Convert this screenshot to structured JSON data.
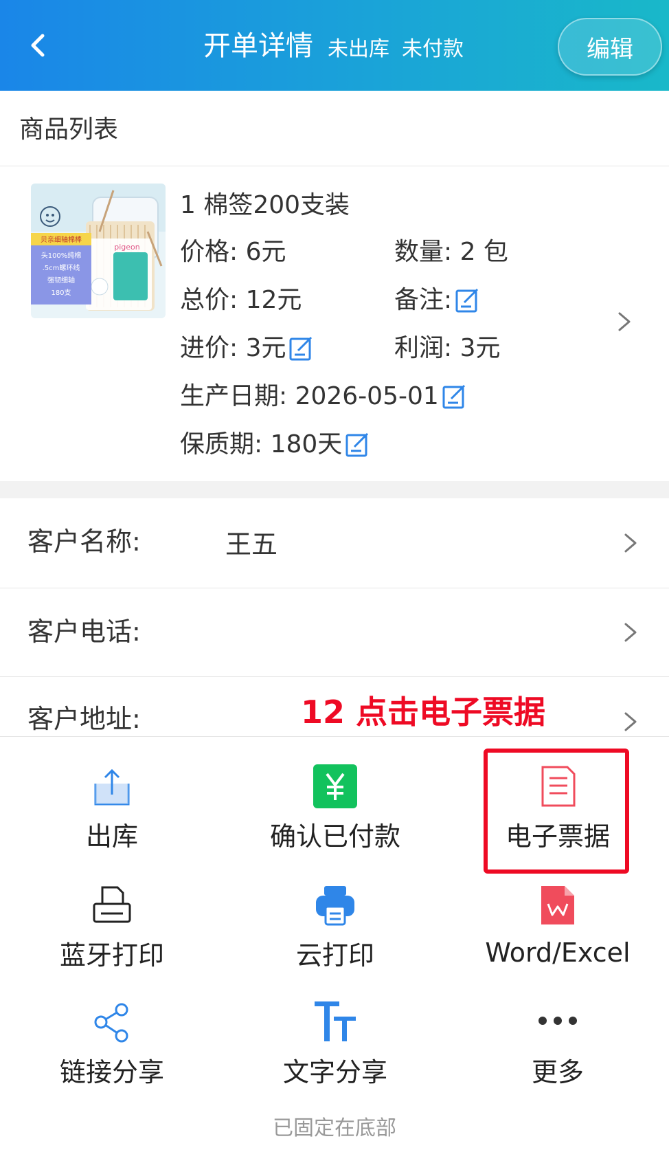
{
  "header": {
    "title": "开单详情",
    "status_stock": "未出库",
    "status_payment": "未付款",
    "edit_label": "编辑"
  },
  "product_section": {
    "title": "商品列表"
  },
  "product": {
    "name": "1 棉签200支装",
    "price": "价格: 6元",
    "quantity": "数量: 2 包",
    "total": "总价: 12元",
    "remark": "备注:",
    "cost": "进价: 3元",
    "profit": "利润: 3元",
    "production_date": "生产日期: 2026-05-01",
    "shelf_life": "保质期: 180天",
    "image_text": {
      "brand": "pigeon",
      "line1": "贝亲细轴棉棒",
      "line2": "头100%纯棉",
      "line3": ".5cm螺环线",
      "line4": "强韧细轴",
      "line5": "180支"
    }
  },
  "customer": {
    "name_label": "客户名称:",
    "name_value": "王五",
    "phone_label": "客户电话:",
    "address_label": "客户地址:"
  },
  "annotation": "12 点击电子票据",
  "actions": [
    {
      "label": "出库",
      "icon": "export-icon"
    },
    {
      "label": "确认已付款",
      "icon": "yen-icon"
    },
    {
      "label": "电子票据",
      "icon": "document-icon"
    },
    {
      "label": "蓝牙打印",
      "icon": "printer-outline-icon"
    },
    {
      "label": "云打印",
      "icon": "printer-filled-icon"
    },
    {
      "label": "Word/Excel",
      "icon": "wps-file-icon"
    },
    {
      "label": "链接分享",
      "icon": "share-icon"
    },
    {
      "label": "文字分享",
      "icon": "text-size-icon"
    },
    {
      "label": "更多",
      "icon": "more-dots-icon"
    }
  ],
  "footer_note": "已固定在底部",
  "colors": {
    "header_start": "#1a86e8",
    "header_end": "#19b8c9",
    "accent_blue": "#2f86e8",
    "green": "#12c25d",
    "red": "#ee0a24",
    "pink": "#f04c5c"
  }
}
